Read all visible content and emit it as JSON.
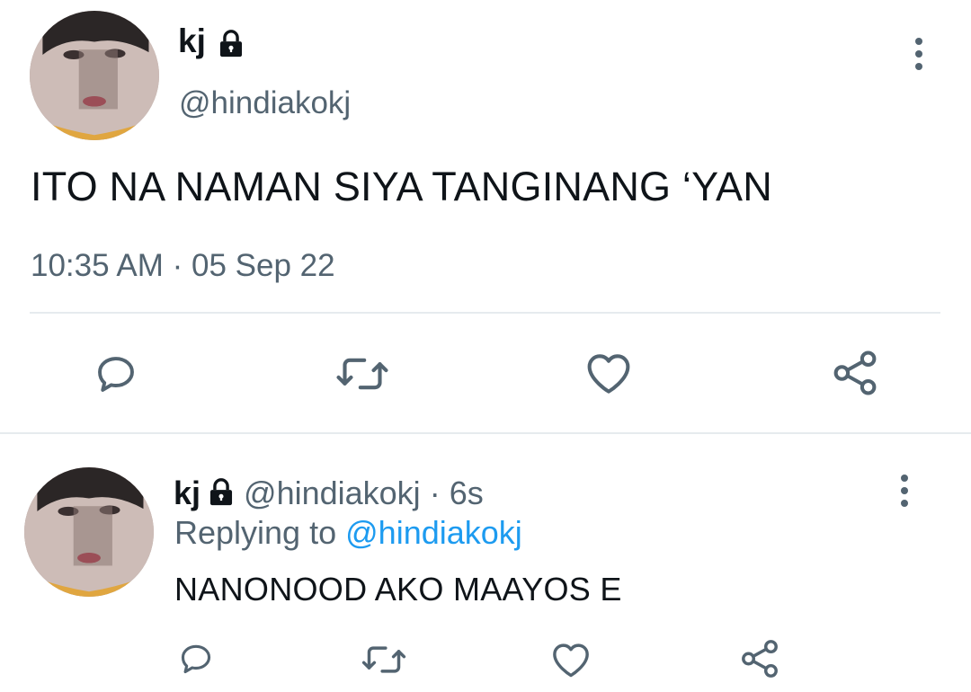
{
  "main_tweet": {
    "display_name": "kj",
    "handle": "@hindiakokj",
    "text": "ITO NA NAMAN SIYA TANGINANG ‘YAN",
    "meta": "10:35 AM · 05 Sep 22",
    "avatar": "profile-photo",
    "badge_icon": "lock-icon",
    "more_icon": "more-vertical-icon",
    "actions": [
      "reply-icon",
      "retweet-icon",
      "like-icon",
      "share-icon"
    ]
  },
  "reply_tweet": {
    "display_name": "kj",
    "handle": "@hindiakokj",
    "separator": "·",
    "time": "6s",
    "replying_prefix": "Replying to",
    "replying_to": "@hindiakokj",
    "text": "NANONOOD AKO MAAYOS E",
    "avatar": "profile-photo",
    "badge_icon": "lock-icon",
    "more_icon": "more-vertical-icon",
    "actions": [
      "reply-icon",
      "retweet-icon",
      "like-icon",
      "share-icon"
    ]
  },
  "colors": {
    "text_primary": "#0f1419",
    "text_secondary": "#536471",
    "link": "#1d9bf0",
    "divider": "#e6ebee",
    "icon": "#536471"
  }
}
